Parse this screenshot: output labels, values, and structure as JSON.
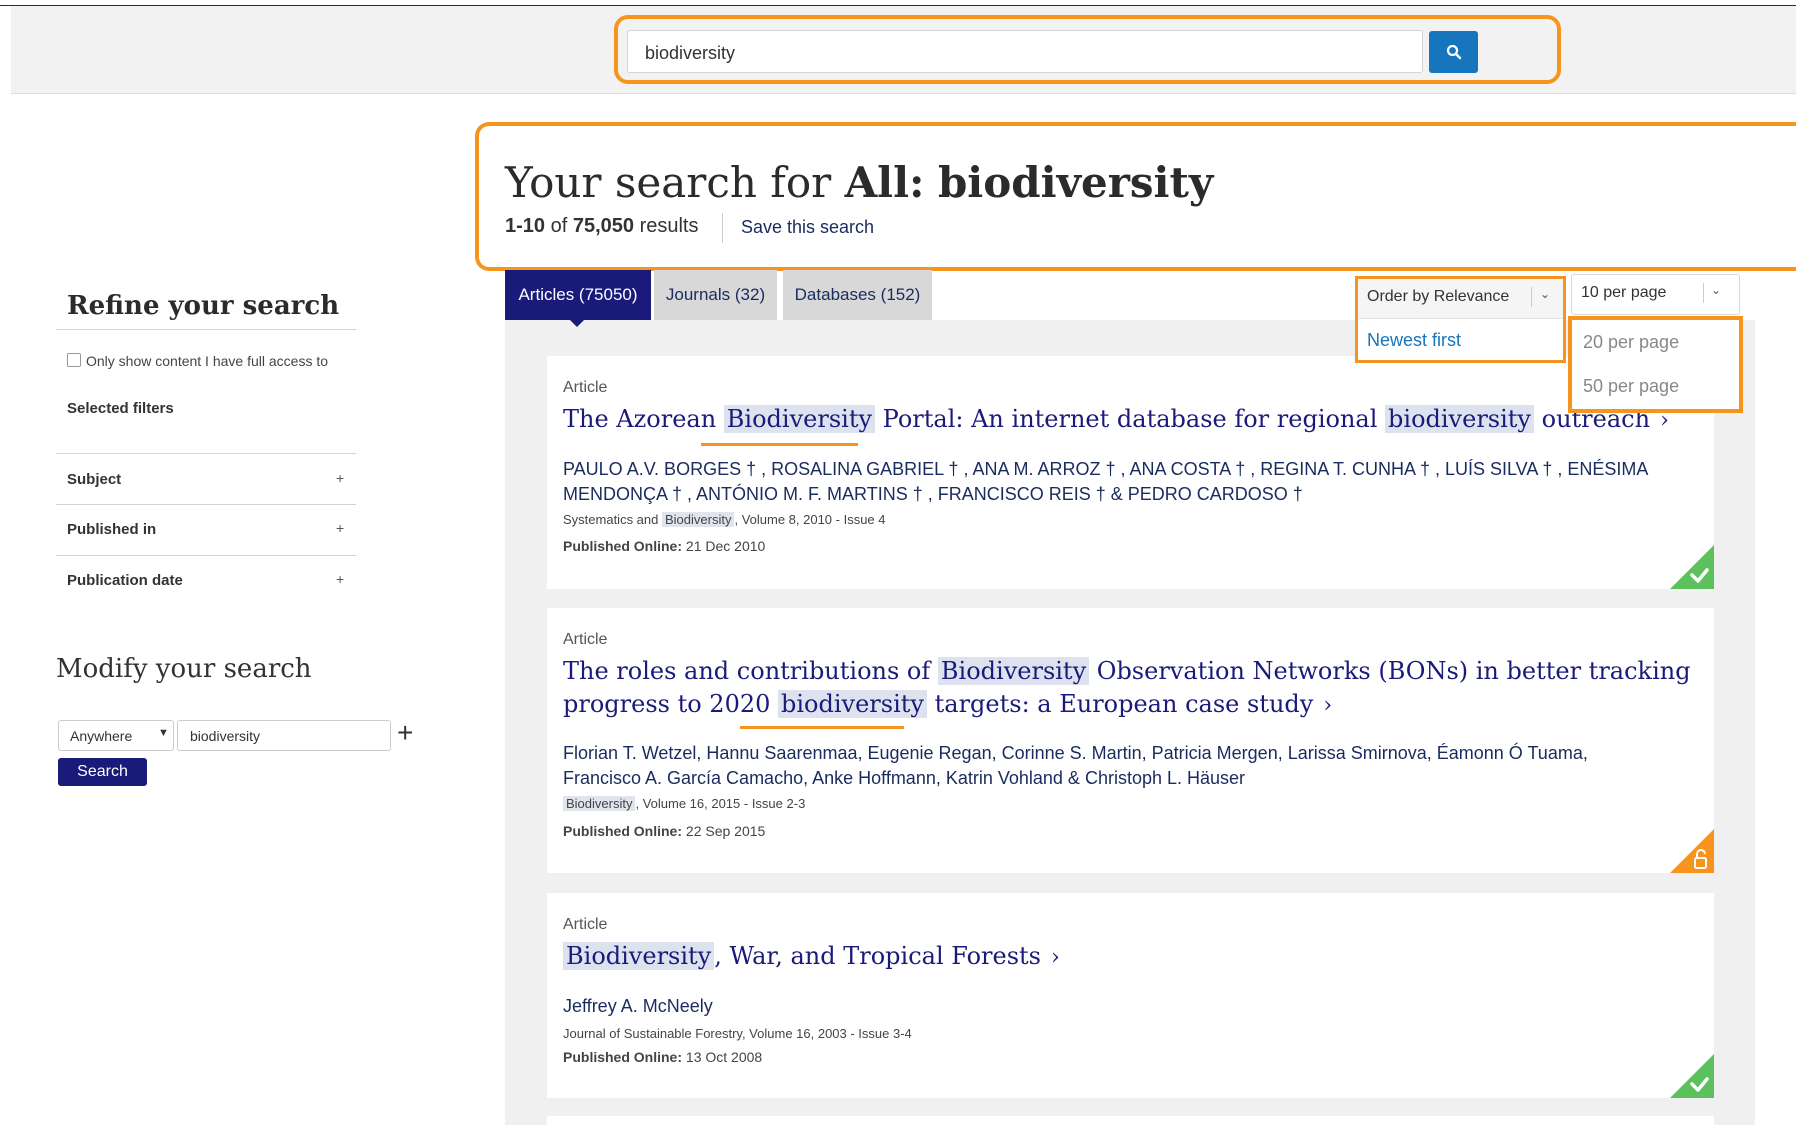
{
  "search": {
    "query": "biodiversity"
  },
  "header": {
    "heading_prefix": "Your search for ",
    "heading_scope": "All:",
    "heading_term": "biodiversity",
    "range": "1-10",
    "of": "of",
    "total": "75,050",
    "results_word": "results",
    "save_search": "Save this search"
  },
  "sidebar": {
    "refine_title": "Refine your search",
    "access_label": "Only show content I have full access to",
    "selected_filters": "Selected filters",
    "facets": [
      "Subject",
      "Published in",
      "Publication date"
    ],
    "facet_plus": "+",
    "modify_title": "Modify your search",
    "scope_value": "Anywhere",
    "modify_query": "biodiversity",
    "add_row": "+",
    "search_button": "Search"
  },
  "tabs": [
    {
      "label": "Articles (75050)"
    },
    {
      "label": "Journals (32)"
    },
    {
      "label": "Databases (152)"
    }
  ],
  "order": {
    "selected": "Order by Relevance",
    "options": [
      "Newest first"
    ]
  },
  "per_page": {
    "selected": "10 per page",
    "options": [
      "20 per page",
      "50 per page"
    ]
  },
  "results": [
    {
      "type": "Article",
      "title_parts": [
        "The Azorean ",
        "Biodiversity",
        " Portal: An internet database for regional ",
        "biodiversity",
        " outreach"
      ],
      "authors_line1": "PAULO A.V. BORGES † , ROSALINA GABRIEL † , ANA M. ARROZ † , ANA COSTA † , REGINA T. CUNHA † , LUÍS SILVA † , ENÉSIMA",
      "authors_line2": "MENDONÇA † , ANTÓNIO M. F. MARTINS † , FRANCISCO REIS † & PEDRO CARDOSO †",
      "source_parts": [
        "Systematics and ",
        "Biodiversity",
        ", Volume 8, 2010 - Issue 4"
      ],
      "published_label": "Published Online:",
      "published_date": "21 Dec 2010",
      "access": "full-access"
    },
    {
      "type": "Article",
      "title_line1_parts": [
        "The roles and contributions of ",
        "Biodiversity",
        " Observation Networks (BONs) in better tracking"
      ],
      "title_line2_parts": [
        "progress to 2020 ",
        "biodiversity",
        " targets: a European case study"
      ],
      "authors_line1": "Florian T. Wetzel, Hannu Saarenmaa, Eugenie Regan, Corinne S. Martin, Patricia Mergen, Larissa Smirnova, Éamonn Ó Tuama,",
      "authors_line2": "Francisco A. García Camacho, Anke Hoffmann, Katrin Vohland & Christoph L. Häuser",
      "source_parts": [
        "Biodiversity",
        ", Volume 16, 2015 - Issue 2-3"
      ],
      "published_label": "Published Online:",
      "published_date": "22 Sep 2015",
      "access": "open-access"
    },
    {
      "type": "Article",
      "title_parts": [
        "Biodiversity",
        ", War, and Tropical Forests"
      ],
      "authors_line1": "Jeffrey A. McNeely",
      "source": "Journal of Sustainable Forestry, Volume 16, 2003 - Issue 3-4",
      "published_label": "Published Online:",
      "published_date": "13 Oct 2008",
      "access": "full-access"
    }
  ],
  "colors": {
    "highlight": "#f7941d",
    "primary": "#1a1a7a",
    "search_button": "#1675bc",
    "full_access": "#5cc05c",
    "open_access": "#f7941d"
  },
  "icons": {
    "search": "search-icon",
    "full_access": "checkmark-icon",
    "open_access": "open-lock-icon",
    "dropdown": "chevron-down-icon"
  }
}
